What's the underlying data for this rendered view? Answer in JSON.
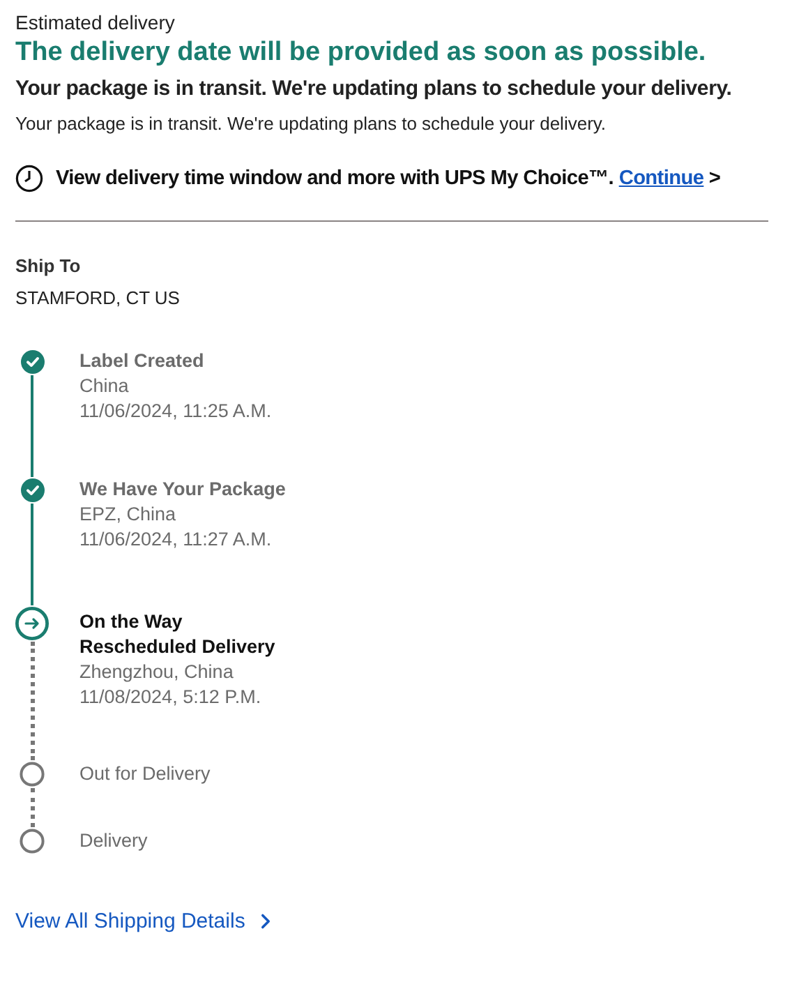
{
  "estimate": {
    "label": "Estimated delivery",
    "headline": "The delivery date will be provided as soon as possible.",
    "subhead": "Your package is in transit. We're updating plans to schedule your delivery.",
    "body": "Your package is in transit. We're updating plans to schedule your delivery."
  },
  "promo": {
    "text": "View delivery time window and more with UPS My Choice™.",
    "link": "Continue",
    "arrow": ">"
  },
  "ship_to": {
    "label": "Ship To",
    "value": "STAMFORD, CT US"
  },
  "steps": [
    {
      "kind": "done",
      "title": "Label Created",
      "location": "China",
      "time": "11/06/2024, 11:25 A.M."
    },
    {
      "kind": "done",
      "title": "We Have Your Package",
      "location": "EPZ, China",
      "time": "11/06/2024, 11:27 A.M."
    },
    {
      "kind": "current",
      "title": "On the Way",
      "note": "Rescheduled Delivery",
      "location": "Zhengzhou, China",
      "time": "11/08/2024, 5:12 P.M."
    },
    {
      "kind": "pending",
      "title": "Out for Delivery"
    },
    {
      "kind": "pending",
      "title": "Delivery"
    }
  ],
  "details_link": "View All Shipping Details"
}
